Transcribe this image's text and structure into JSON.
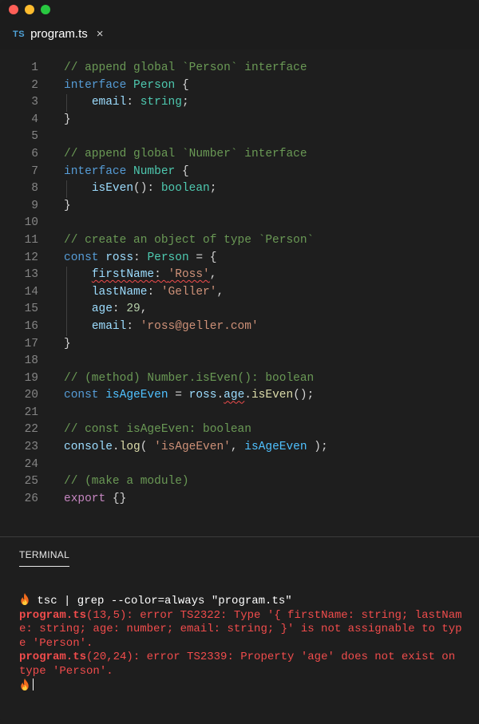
{
  "window": {
    "tab_badge": "TS",
    "tab_title": "program.ts",
    "close_glyph": "×"
  },
  "colors": {
    "comment": "#6a9955",
    "keyword": "#569cd6",
    "type": "#4ec9b0",
    "string": "#ce9178",
    "number": "#b5cea8",
    "error": "#f14c4c"
  },
  "editor": {
    "lines": [
      {
        "n": "1",
        "parts": [
          {
            "t": "// append global `Person` interface",
            "c": "c-com"
          }
        ]
      },
      {
        "n": "2",
        "parts": [
          {
            "t": "interface",
            "c": "c-kw"
          },
          {
            "t": " ",
            "c": "c-punc"
          },
          {
            "t": "Person",
            "c": "c-type"
          },
          {
            "t": " {",
            "c": "c-punc"
          }
        ]
      },
      {
        "n": "3",
        "parts": [
          {
            "t": "    ",
            "c": "c-punc"
          },
          {
            "t": "email",
            "c": "c-var"
          },
          {
            "t": ": ",
            "c": "c-punc"
          },
          {
            "t": "string",
            "c": "c-type"
          },
          {
            "t": ";",
            "c": "c-punc"
          }
        ]
      },
      {
        "n": "4",
        "parts": [
          {
            "t": "}",
            "c": "c-punc"
          }
        ]
      },
      {
        "n": "5",
        "parts": []
      },
      {
        "n": "6",
        "parts": [
          {
            "t": "// append global `Number` interface",
            "c": "c-com"
          }
        ]
      },
      {
        "n": "7",
        "parts": [
          {
            "t": "interface",
            "c": "c-kw"
          },
          {
            "t": " ",
            "c": "c-punc"
          },
          {
            "t": "Number",
            "c": "c-type"
          },
          {
            "t": " {",
            "c": "c-punc"
          }
        ]
      },
      {
        "n": "8",
        "parts": [
          {
            "t": "    ",
            "c": "c-punc"
          },
          {
            "t": "isEven",
            "c": "c-var"
          },
          {
            "t": "(): ",
            "c": "c-punc"
          },
          {
            "t": "boolean",
            "c": "c-type"
          },
          {
            "t": ";",
            "c": "c-punc"
          }
        ]
      },
      {
        "n": "9",
        "parts": [
          {
            "t": "}",
            "c": "c-punc"
          }
        ]
      },
      {
        "n": "10",
        "parts": []
      },
      {
        "n": "11",
        "parts": [
          {
            "t": "// create an object of type `Person`",
            "c": "c-com"
          }
        ]
      },
      {
        "n": "12",
        "parts": [
          {
            "t": "const",
            "c": "c-kw"
          },
          {
            "t": " ",
            "c": "c-punc"
          },
          {
            "t": "ross",
            "c": "c-var"
          },
          {
            "t": ": ",
            "c": "c-punc"
          },
          {
            "t": "Person",
            "c": "c-type"
          },
          {
            "t": " = {",
            "c": "c-punc"
          }
        ]
      },
      {
        "n": "13",
        "parts": [
          {
            "t": "    ",
            "c": "c-punc"
          },
          {
            "t": "firstName: 'Ross'",
            "c": "mixed-squiggle"
          },
          {
            "t": ",",
            "c": "c-punc"
          }
        ]
      },
      {
        "n": "14",
        "parts": [
          {
            "t": "    ",
            "c": "c-punc"
          },
          {
            "t": "lastName",
            "c": "c-var"
          },
          {
            "t": ": ",
            "c": "c-punc"
          },
          {
            "t": "'Geller'",
            "c": "c-str"
          },
          {
            "t": ",",
            "c": "c-punc"
          }
        ]
      },
      {
        "n": "15",
        "parts": [
          {
            "t": "    ",
            "c": "c-punc"
          },
          {
            "t": "age",
            "c": "c-var"
          },
          {
            "t": ": ",
            "c": "c-punc"
          },
          {
            "t": "29",
            "c": "c-num"
          },
          {
            "t": ",",
            "c": "c-punc"
          }
        ]
      },
      {
        "n": "16",
        "parts": [
          {
            "t": "    ",
            "c": "c-punc"
          },
          {
            "t": "email",
            "c": "c-var"
          },
          {
            "t": ": ",
            "c": "c-punc"
          },
          {
            "t": "'ross@geller.com'",
            "c": "c-str"
          }
        ]
      },
      {
        "n": "17",
        "parts": [
          {
            "t": "}",
            "c": "c-punc"
          }
        ]
      },
      {
        "n": "18",
        "parts": []
      },
      {
        "n": "19",
        "parts": [
          {
            "t": "// (method) Number.isEven(): boolean",
            "c": "c-com"
          }
        ]
      },
      {
        "n": "20",
        "parts": [
          {
            "t": "const",
            "c": "c-kw"
          },
          {
            "t": " ",
            "c": "c-punc"
          },
          {
            "t": "isAgeEven",
            "c": "c-var2"
          },
          {
            "t": " = ",
            "c": "c-punc"
          },
          {
            "t": "ross",
            "c": "c-var"
          },
          {
            "t": ".",
            "c": "c-punc"
          },
          {
            "t": "age",
            "c": "c-var squiggle"
          },
          {
            "t": ".",
            "c": "c-punc"
          },
          {
            "t": "isEven",
            "c": "c-fn"
          },
          {
            "t": "();",
            "c": "c-punc"
          }
        ]
      },
      {
        "n": "21",
        "parts": []
      },
      {
        "n": "22",
        "parts": [
          {
            "t": "// const isAgeEven: boolean",
            "c": "c-com"
          }
        ]
      },
      {
        "n": "23",
        "parts": [
          {
            "t": "console",
            "c": "c-var"
          },
          {
            "t": ".",
            "c": "c-punc"
          },
          {
            "t": "log",
            "c": "c-fn"
          },
          {
            "t": "( ",
            "c": "c-punc"
          },
          {
            "t": "'isAgeEven'",
            "c": "c-str"
          },
          {
            "t": ", ",
            "c": "c-punc"
          },
          {
            "t": "isAgeEven",
            "c": "c-var2"
          },
          {
            "t": " );",
            "c": "c-punc"
          }
        ]
      },
      {
        "n": "24",
        "parts": []
      },
      {
        "n": "25",
        "parts": [
          {
            "t": "// (make a module)",
            "c": "c-com"
          }
        ]
      },
      {
        "n": "26",
        "parts": [
          {
            "t": "export",
            "c": "c-kw2"
          },
          {
            "t": " {}",
            "c": "c-punc"
          }
        ]
      }
    ]
  },
  "terminal": {
    "tab_label": "TERMINAL",
    "command": " tsc | grep --color=always \"program.ts\"",
    "errors": [
      {
        "file": "program.ts",
        "rest": "(13,5): error TS2322: Type '{ firstName: string; lastName: string; age: number; email: string; }' is not assignable to type 'Person'."
      },
      {
        "file": "program.ts",
        "rest": "(20,24): error TS2339: Property 'age' does not exist on type 'Person'."
      }
    ]
  }
}
